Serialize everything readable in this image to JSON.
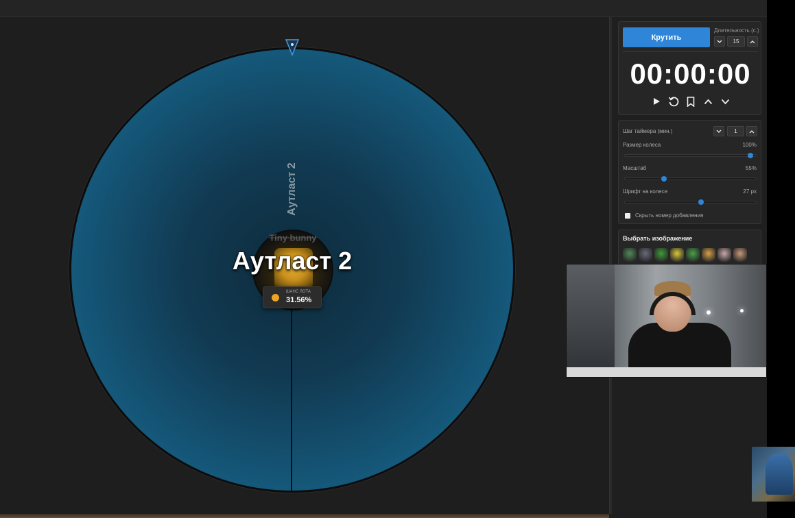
{
  "wheel": {
    "slice_label": "Аутласт 2",
    "hub_subtitle": "Tiny bunny",
    "winner_title": "Аутласт 2",
    "chance_caption": "ШАНС ЛОТА",
    "chance_value": "31.56%",
    "wheel_color": "#176b91",
    "chance_dot_color": "#f0a322"
  },
  "controls": {
    "spin_label": "Крутить",
    "duration_label": "Длительность (с.)",
    "duration_value": "15",
    "timer_display": "00:00:00",
    "accent_color": "#2f86d9",
    "icons": [
      "play-icon",
      "reset-icon",
      "bookmark-icon",
      "chevron-up-icon",
      "chevron-down-icon"
    ]
  },
  "settings": {
    "timer_step_label": "Шаг таймера (мин.)",
    "timer_step_value": "1",
    "wheel_size_label": "Размер колеса",
    "wheel_size_value": "100%",
    "wheel_size_fraction": 1.0,
    "scale_label": "Масштаб",
    "scale_value": "55%",
    "scale_fraction": 0.3,
    "font_label": "Шрифт на колесе",
    "font_value": "27 px",
    "font_fraction": 0.58,
    "hide_number_label": "Скрыть номер добавления",
    "hide_number_checked": false
  },
  "images": {
    "title": "Выбрать изображение",
    "sticker_colors": [
      "#4f8a5a",
      "#6a6a7a",
      "#3f9a3a",
      "#d8c83a",
      "#4aa04a",
      "#d8a04a",
      "#c8a8a8",
      "#c89878"
    ]
  }
}
